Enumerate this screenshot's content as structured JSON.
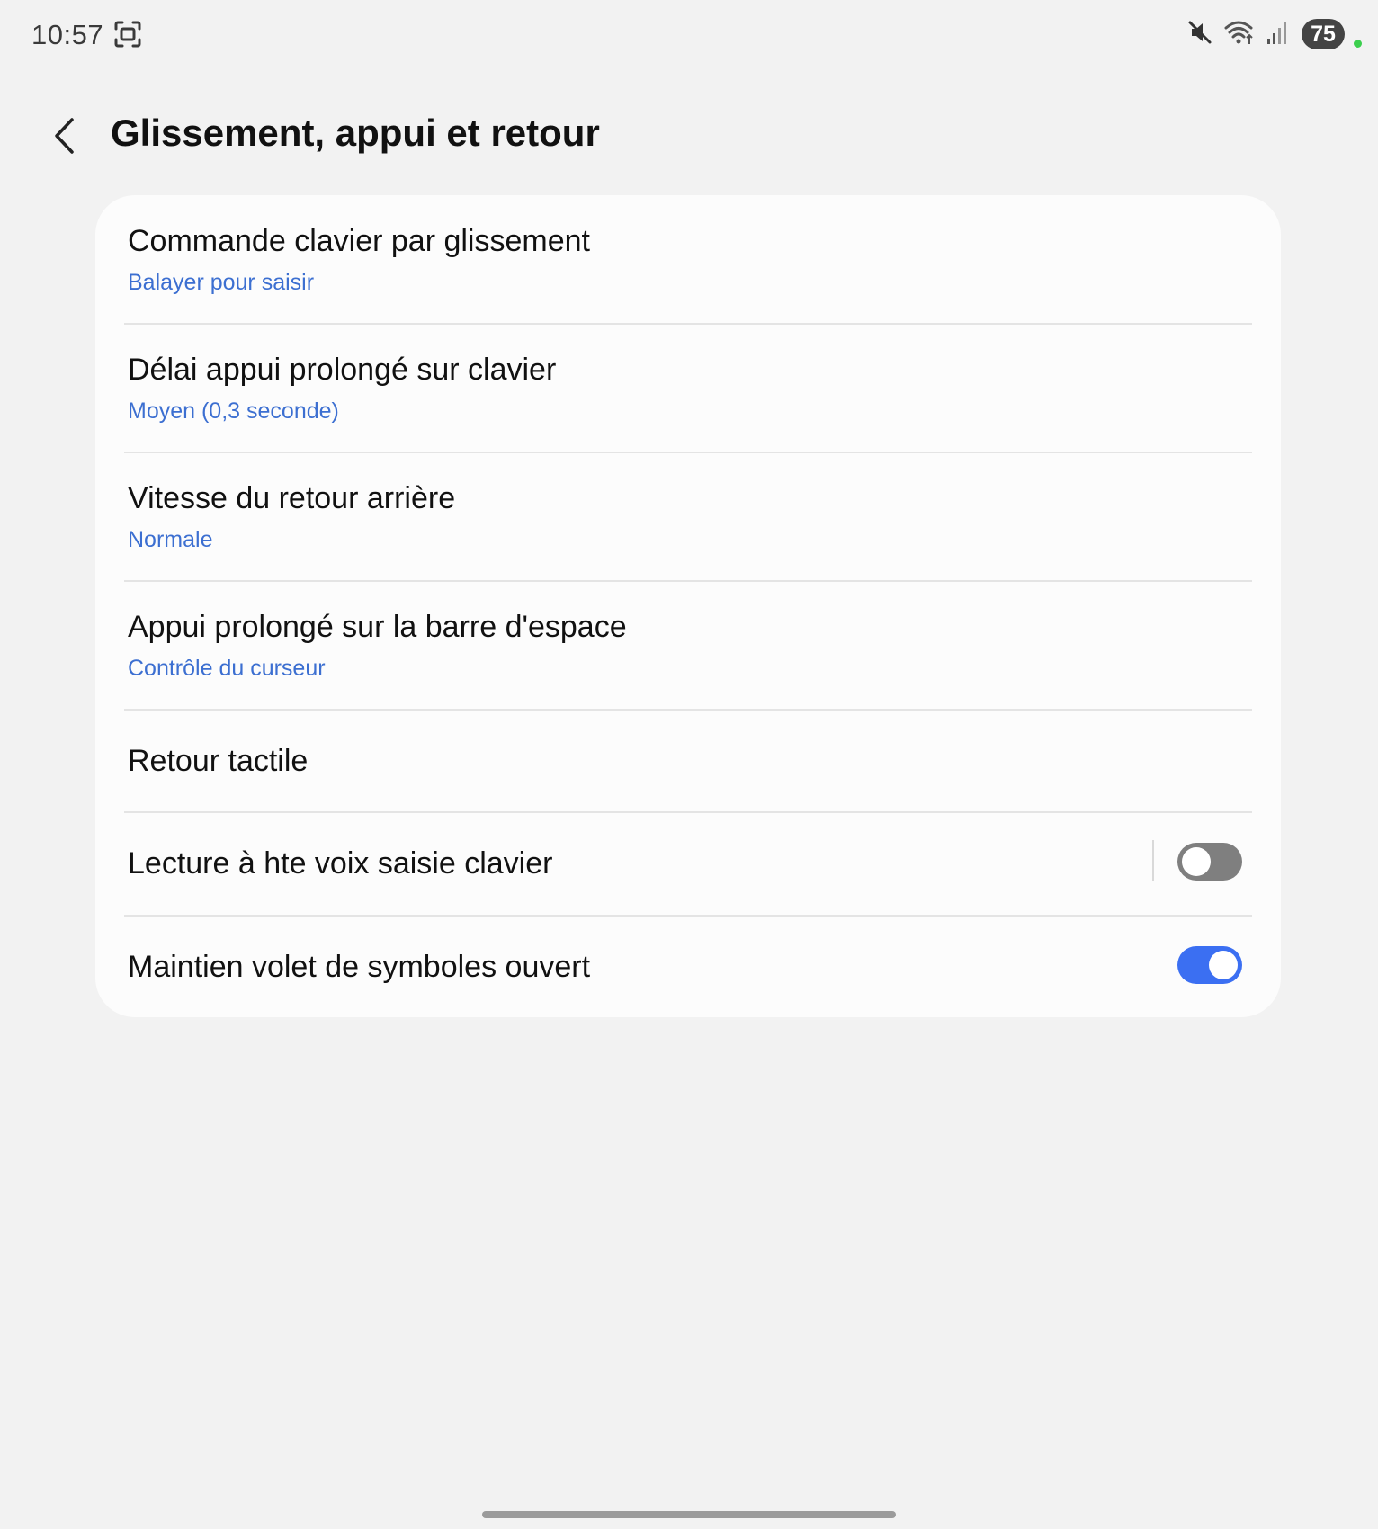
{
  "status_bar": {
    "time": "10:57",
    "battery": "75",
    "icons": [
      "screenshot-icon",
      "mute-icon",
      "wifi-icon",
      "signal-icon"
    ]
  },
  "header": {
    "title": "Glissement, appui et retour",
    "back_icon": "chevron-left-icon"
  },
  "settings": [
    {
      "title": "Commande clavier par glissement",
      "subtitle": "Balayer pour saisir"
    },
    {
      "title": "Délai appui prolongé sur clavier",
      "subtitle": "Moyen (0,3 seconde)"
    },
    {
      "title": "Vitesse du retour arrière",
      "subtitle": "Normale"
    },
    {
      "title": "Appui prolongé sur la barre d'espace",
      "subtitle": "Contrôle du curseur"
    },
    {
      "title": "Retour tactile"
    },
    {
      "title": "Lecture à hte voix saisie clavier",
      "toggle": false
    },
    {
      "title": "Maintien volet de symboles ouvert",
      "toggle": true
    }
  ],
  "colors": {
    "background": "#f2f2f2",
    "card": "#fcfcfc",
    "subtitle": "#3c6fd1",
    "toggle_on": "#3b6ff2",
    "toggle_off": "#7f7f7f"
  }
}
